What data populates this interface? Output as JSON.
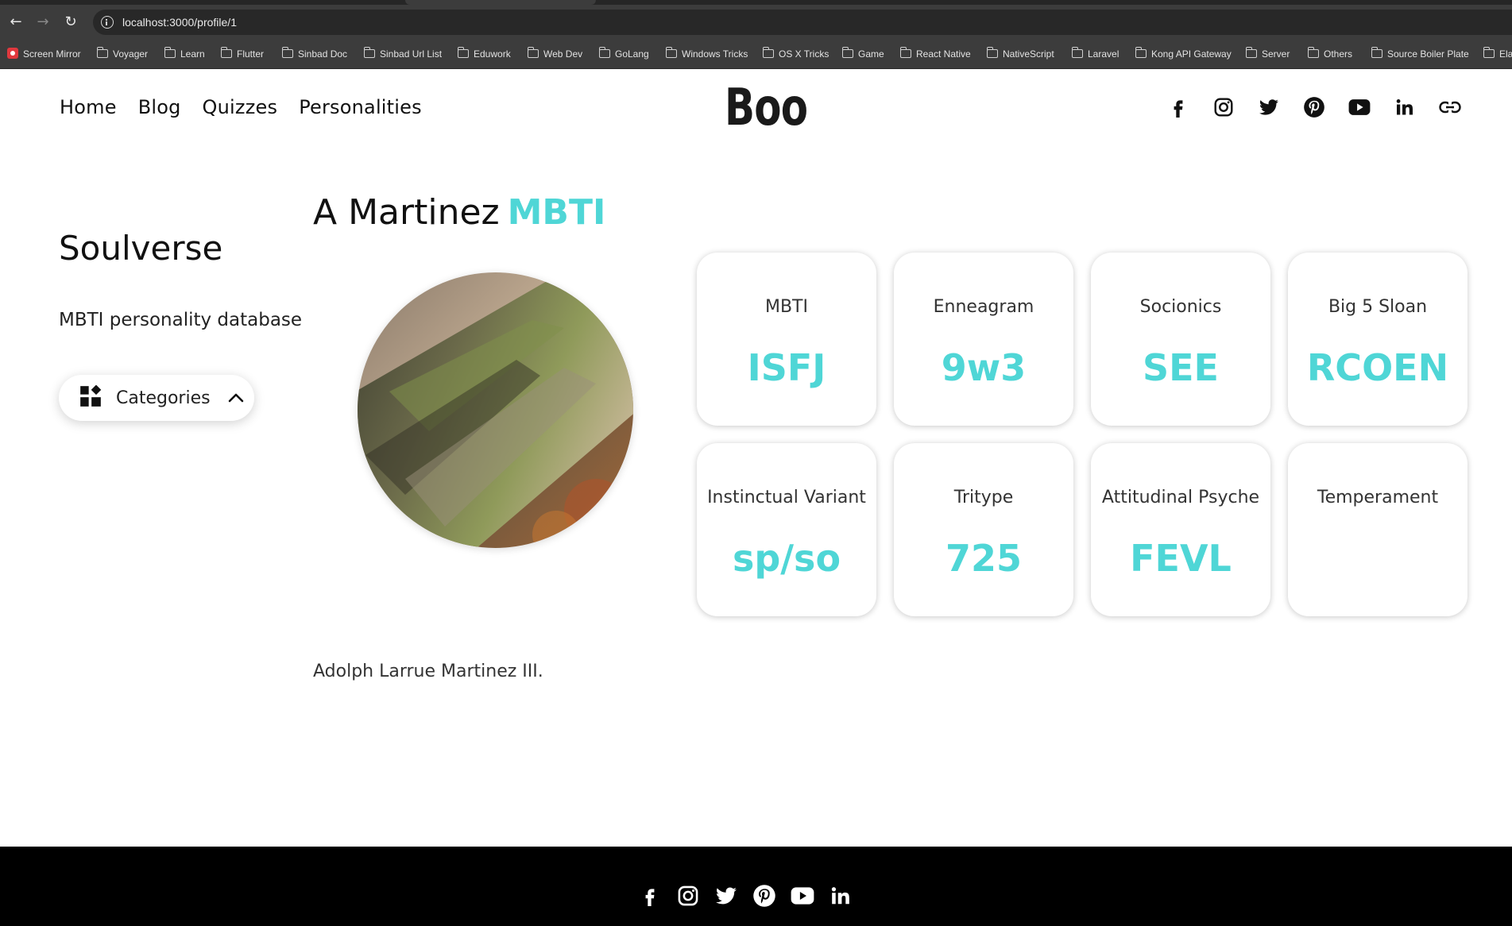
{
  "browser": {
    "url": "localhost:3000/profile/1",
    "bookmarks": [
      {
        "label": "Screen Mirror",
        "icon": "record-icon"
      },
      {
        "label": "Voyager",
        "icon": "folder-icon"
      },
      {
        "label": "Learn",
        "icon": "folder-icon"
      },
      {
        "label": "Flutter",
        "icon": "folder-icon"
      },
      {
        "label": "Sinbad Doc",
        "icon": "folder-icon"
      },
      {
        "label": "Sinbad Url List",
        "icon": "folder-icon"
      },
      {
        "label": "Eduwork",
        "icon": "folder-icon"
      },
      {
        "label": "Web Dev",
        "icon": "folder-icon"
      },
      {
        "label": "GoLang",
        "icon": "folder-icon"
      },
      {
        "label": "Windows Tricks",
        "icon": "folder-icon"
      },
      {
        "label": "OS X Tricks",
        "icon": "folder-icon"
      },
      {
        "label": "Game",
        "icon": "folder-icon"
      },
      {
        "label": "React Native",
        "icon": "folder-icon"
      },
      {
        "label": "NativeScript",
        "icon": "folder-icon"
      },
      {
        "label": "Laravel",
        "icon": "folder-icon"
      },
      {
        "label": "Kong API Gateway",
        "icon": "folder-icon"
      },
      {
        "label": "Server",
        "icon": "folder-icon"
      },
      {
        "label": "Others",
        "icon": "folder-icon"
      },
      {
        "label": "Source Boiler Plate",
        "icon": "folder-icon"
      },
      {
        "label": "Ela",
        "icon": "folder-icon"
      }
    ]
  },
  "header": {
    "nav": [
      "Home",
      "Blog",
      "Quizzes",
      "Personalities"
    ],
    "logo": "Boo",
    "social": [
      "facebook-icon",
      "instagram-icon",
      "twitter-icon",
      "pinterest-icon",
      "youtube-icon",
      "linkedin-icon",
      "link-icon"
    ]
  },
  "sidebar": {
    "title": "Soulverse",
    "subtitle": "MBTI personality database",
    "categories_label": "Categories"
  },
  "profile": {
    "name": "A Martinez",
    "name_tag": "MBTI",
    "bio": "Adolph Larrue Martinez III.",
    "cards": [
      {
        "label": "MBTI",
        "value": "ISFJ"
      },
      {
        "label": "Enneagram",
        "value": "9w3"
      },
      {
        "label": "Socionics",
        "value": "SEE"
      },
      {
        "label": "Big 5 Sloan",
        "value": "RCOEN"
      },
      {
        "label": "Instinctual Variant",
        "value": "sp/so"
      },
      {
        "label": "Tritype",
        "value": "725"
      },
      {
        "label": "Attitudinal Psyche",
        "value": "FEVL"
      },
      {
        "label": "Temperament",
        "value": ""
      }
    ]
  },
  "footer": {
    "social": [
      "facebook-icon",
      "instagram-icon",
      "twitter-icon",
      "pinterest-icon",
      "youtube-icon",
      "linkedin-icon"
    ]
  },
  "colors": {
    "accent": "#4fd6d6",
    "footer_bg": "#000000",
    "chrome_bg": "#3c3c3c"
  }
}
